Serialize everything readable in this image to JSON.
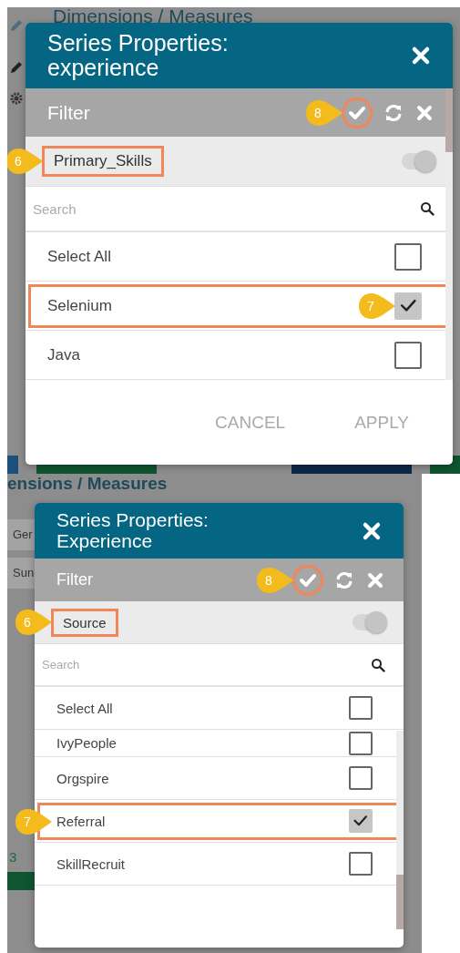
{
  "panels": [
    {
      "background": {
        "labels": [
          {
            "kind": "heading",
            "text": "Dimensions / Measures"
          }
        ]
      },
      "dialog": {
        "title": "Series Properties: experience",
        "filter_label": "Filter",
        "apply_callout": "8",
        "field": {
          "label": "Primary_Skills",
          "highlighted": true,
          "callout": "6"
        },
        "toggle": {
          "on": true
        },
        "search": {
          "placeholder": "Search"
        },
        "items": [
          {
            "label": "Select All",
            "checked": false,
            "highlighted": false,
            "clipped": false
          },
          {
            "label": "Selenium",
            "checked": true,
            "highlighted": true,
            "clipped": false,
            "callout": "7"
          },
          {
            "label": "Java",
            "checked": false,
            "highlighted": false,
            "clipped": false
          }
        ],
        "buttons": [
          "CANCEL",
          "APPLY"
        ]
      }
    },
    {
      "background": {
        "labels": [
          {
            "kind": "heading",
            "text": "ensions / Measures"
          },
          {
            "kind": "tab",
            "text": "Ger"
          },
          {
            "kind": "tab",
            "text": "Sun"
          },
          {
            "kind": "value",
            "text": "3"
          }
        ]
      },
      "dialog": {
        "title": "Series Properties: Experience",
        "filter_label": "Filter",
        "apply_callout": "8",
        "field": {
          "label": "Source",
          "highlighted": true,
          "callout": "6"
        },
        "toggle": {
          "on": true
        },
        "search": {
          "placeholder": "Search"
        },
        "items": [
          {
            "label": "Select All",
            "checked": false,
            "highlighted": false,
            "clipped": false
          },
          {
            "label": "IvyPeople",
            "checked": false,
            "highlighted": false,
            "clipped": true
          },
          {
            "label": "Orgspire",
            "checked": false,
            "highlighted": false,
            "clipped": false
          },
          {
            "label": "Referral",
            "checked": true,
            "highlighted": true,
            "clipped": false,
            "callout": "7"
          },
          {
            "label": "SkillRecruit",
            "checked": false,
            "highlighted": false,
            "clipped": false
          }
        ]
      }
    }
  ]
}
